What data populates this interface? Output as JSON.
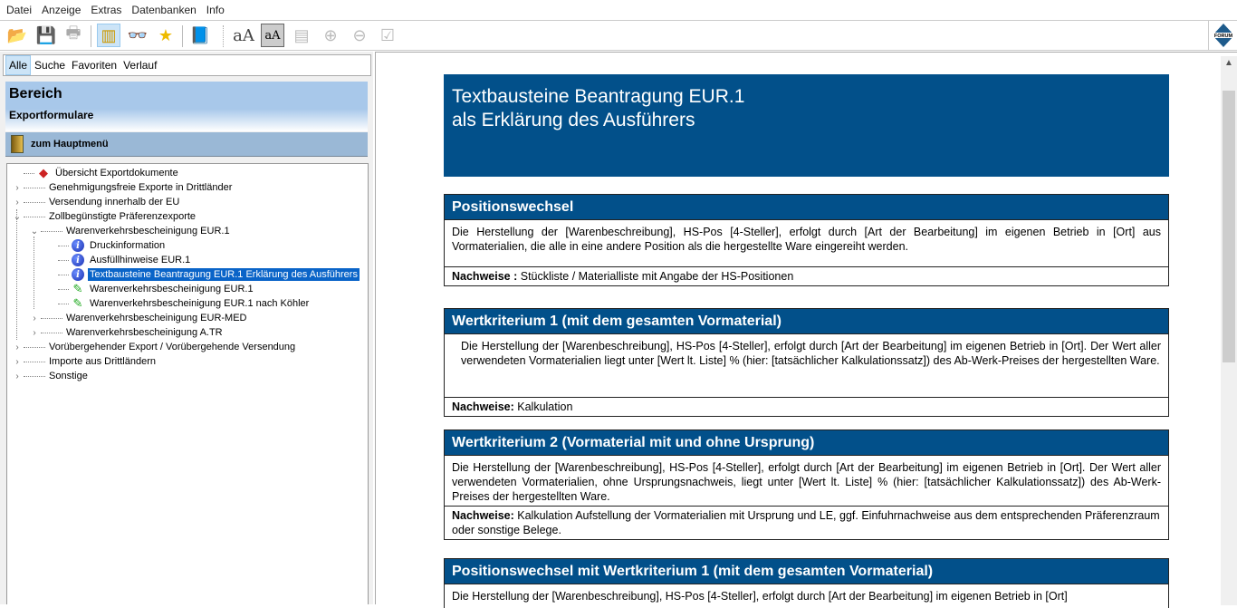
{
  "menu": [
    "Datei",
    "Anzeige",
    "Extras",
    "Datenbanken",
    "Info"
  ],
  "toolbar": {
    "logo": "FORUM"
  },
  "tabs": [
    "Alle",
    "Suche",
    "Favoriten",
    "Verlauf"
  ],
  "bereich": {
    "title": "Bereich",
    "subtitle": "Exportformulare"
  },
  "haupt": "zum Hauptmenü",
  "tree": [
    "Übersicht Exportdokumente",
    "Genehmigungsfreie Exporte in Drittländer",
    "Versendung innerhalb der EU",
    "Zollbegünstigte Präferenzexporte",
    "Warenverkehrsbescheinigung EUR.1",
    "Druckinformation",
    "Ausfüllhinweise EUR.1",
    "Textbausteine Beantragung EUR.1 Erklärung des Ausführers",
    "Warenverkehrsbescheinigung EUR.1",
    "Warenverkehrsbescheinigung EUR.1 nach Köhler",
    "Warenverkehrsbescheinigung EUR-MED",
    "Warenverkehrsbescheinigung A.TR",
    "Vorübergehender Export / Vorübergehende Versendung",
    "Importe aus Drittländern",
    "Sonstige"
  ],
  "doc": {
    "title1": "Textbausteine Beantragung EUR.1",
    "title2": "als Erklärung des Ausführers",
    "sections": [
      {
        "heading": "Positionswechsel",
        "body": "Die Herstellung der [Warenbeschreibung], HS-Pos [4-Steller], erfolgt durch [Art der Bearbeitung] im eigenen Betrieb in [Ort] aus Vormaterialien, die alle in eine andere Position als die hergestellte Ware eingereiht werden.",
        "nachweise_label": "Nachweise :",
        "nachweise": " Stückliste / Materialliste mit Angabe der HS-Positionen"
      },
      {
        "heading": "Wertkriterium 1 (mit dem gesamten Vormaterial)",
        "body": "Die Herstellung der [Warenbeschreibung], HS-Pos [4-Steller], erfolgt durch [Art der Bearbeitung] im eigenen Betrieb in [Ort]. Der Wert aller verwendeten Vormaterialien liegt unter [Wert lt. Liste] % (hier: [tatsächlicher Kalkulationssatz]) des Ab-Werk-Preises der hergestellten Ware.",
        "nachweise_label": "Nachweise:",
        "nachweise": " Kalkulation"
      },
      {
        "heading": "Wertkriterium 2 (Vormaterial mit und ohne Ursprung)",
        "body": "Die Herstellung der [Warenbeschreibung], HS-Pos [4-Steller], erfolgt durch [Art der Bearbeitung] im eigenen Betrieb in [Ort]. Der Wert aller verwendeten Vormaterialien, ohne Ursprungsnachweis, liegt unter [Wert lt. Liste] % (hier: [tatsächlicher Kalkulationssatz]) des Ab-Werk- Preises der hergestellten Ware.",
        "nachweise_label": "Nachweise:",
        "nachweise": " Kalkulation Aufstellung der Vormaterialien mit Ursprung und LE, ggf. Einfuhrnachweise aus dem entsprechenden Präferenzraum oder sonstige Belege."
      },
      {
        "heading": "Positionswechsel mit Wertkriterium 1 (mit dem gesamten Vormaterial)",
        "body": "Die Herstellung der [Warenbeschreibung], HS-Pos [4-Steller], erfolgt durch [Art der Bearbeitung] im eigenen Betrieb in [Ort]"
      }
    ]
  }
}
